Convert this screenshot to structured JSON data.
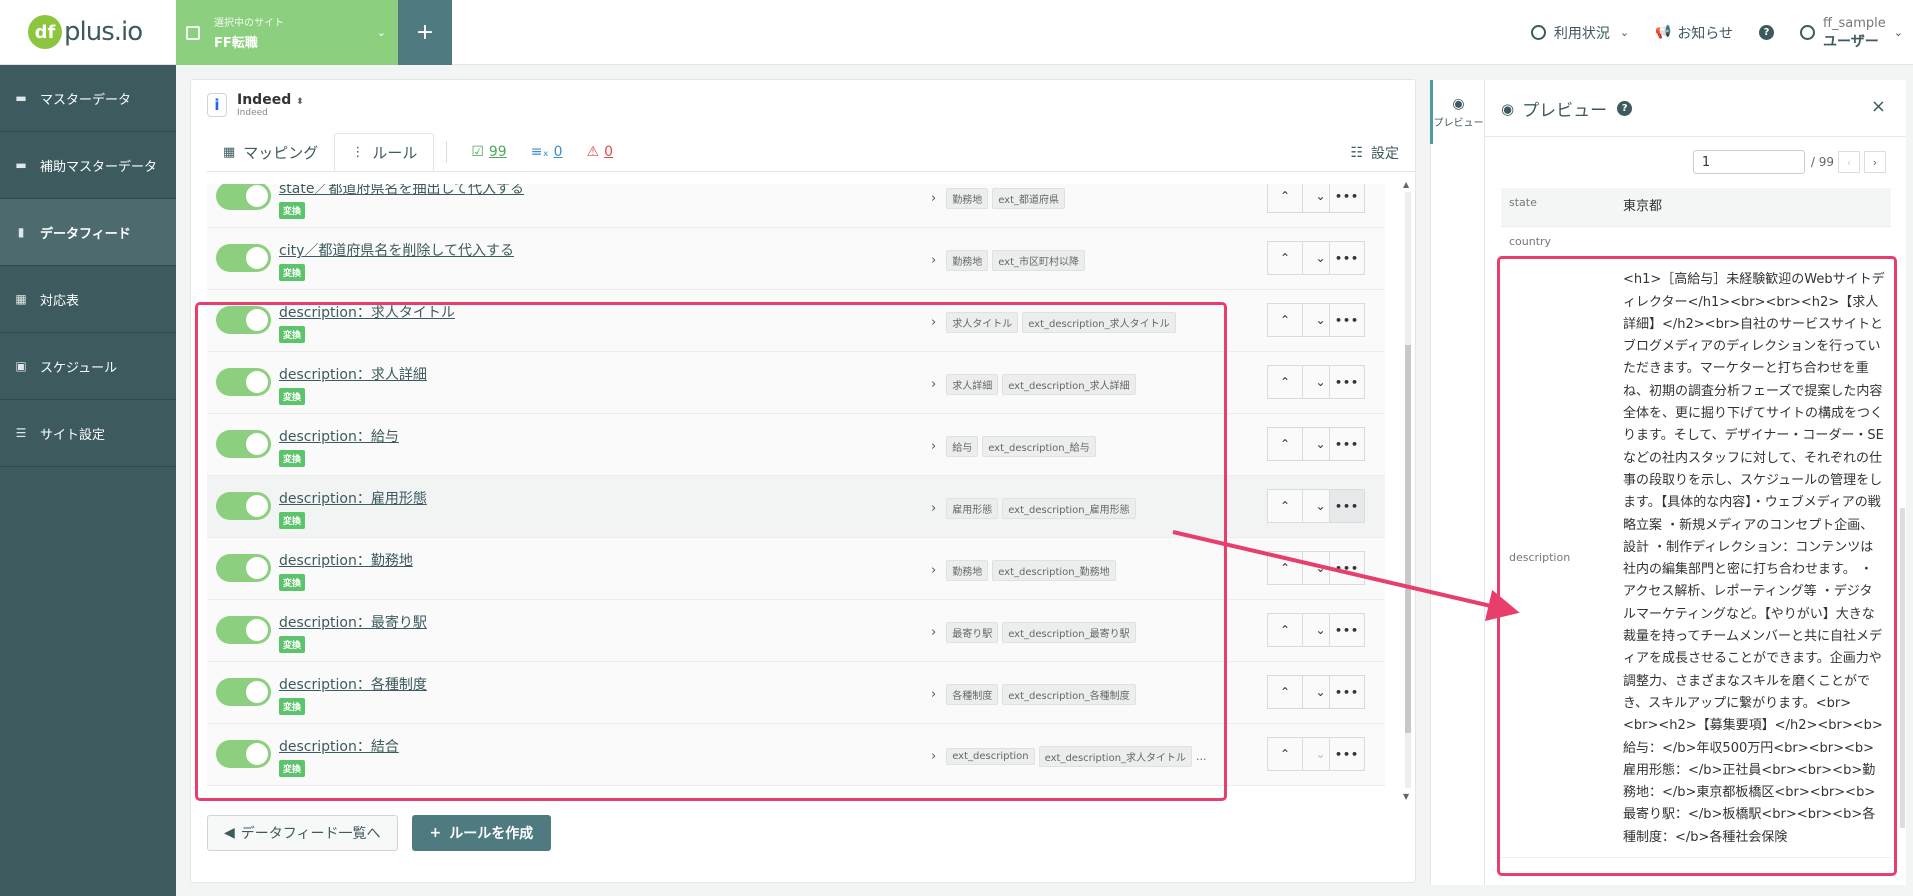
{
  "header": {
    "logo_text": "plus.io",
    "logo_badge": "df",
    "site_label": "選択中のサイト",
    "site_value": "FF転職",
    "add_label": "+",
    "usage_label": "利用状況",
    "news_label": "お知らせ",
    "help_label": "?",
    "user_name": "ff_sample",
    "user_role": "ユーザー"
  },
  "sidebar": {
    "items": [
      {
        "label": "マスターデータ",
        "icon": "folder-icon"
      },
      {
        "label": "補助マスターデータ",
        "icon": "folders-icon"
      },
      {
        "label": "データフィード",
        "icon": "file-icon"
      },
      {
        "label": "対応表",
        "icon": "table-icon"
      },
      {
        "label": "スケジュール",
        "icon": "calendar-icon"
      },
      {
        "label": "サイト設定",
        "icon": "sliders-icon"
      }
    ]
  },
  "feed": {
    "name": "Indeed",
    "sub": "Indeed",
    "icon_letter": "i"
  },
  "tabs": {
    "mapping": "マッピング",
    "rule": "ルール",
    "ok_count": "99",
    "filter_count": "0",
    "warn_count": "0",
    "settings": "設定"
  },
  "rules": [
    {
      "title": "state／都道府県名を抽出して代入する",
      "badge": "変換",
      "tags": [
        "勤務地",
        "ext_都道府県"
      ],
      "more": ""
    },
    {
      "title": "city／都道府県名を削除して代入する",
      "badge": "変換",
      "tags": [
        "勤務地",
        "ext_市区町村以降"
      ],
      "more": ""
    },
    {
      "title": "description：求人タイトル",
      "badge": "変換",
      "tags": [
        "求人タイトル",
        "ext_description_求人タイトル"
      ],
      "more": ""
    },
    {
      "title": "description：求人詳細",
      "badge": "変換",
      "tags": [
        "求人詳細",
        "ext_description_求人詳細"
      ],
      "more": ""
    },
    {
      "title": "description：給与",
      "badge": "変換",
      "tags": [
        "給与",
        "ext_description_給与"
      ],
      "more": ""
    },
    {
      "title": "description：雇用形態",
      "badge": "変換",
      "tags": [
        "雇用形態",
        "ext_description_雇用形態"
      ],
      "more": ""
    },
    {
      "title": "description：勤務地",
      "badge": "変換",
      "tags": [
        "勤務地",
        "ext_description_勤務地"
      ],
      "more": ""
    },
    {
      "title": "description：最寄り駅",
      "badge": "変換",
      "tags": [
        "最寄り駅",
        "ext_description_最寄り駅"
      ],
      "more": ""
    },
    {
      "title": "description：各種制度",
      "badge": "変換",
      "tags": [
        "各種制度",
        "ext_description_各種制度"
      ],
      "more": ""
    },
    {
      "title": "description：結合",
      "badge": "変換",
      "tags": [
        "ext_description",
        "ext_description_求人タイトル"
      ],
      "more": "..."
    }
  ],
  "footer": {
    "back_label": "データフィード一覧へ",
    "create_label": "ルールを作成"
  },
  "preview": {
    "tab_label": "プレビュー",
    "title": "プレビュー",
    "help": "?",
    "close": "×",
    "page_value": "1",
    "page_total": "/ 99",
    "rows": [
      {
        "key": "state",
        "value": "東京都"
      },
      {
        "key": "country",
        "value": ""
      },
      {
        "key": "description",
        "value": "<h1>［高給与］未経験歓迎のWebサイトディレクター</h1><br><br><h2>【求人詳細】</h2><br>自社のサービスサイトとブログメディアのディレクションを行っていただきます。マーケターと打ち合わせを重ね、初期の調査分析フェーズで提案した内容全体を、更に掘り下げてサイトの構成をつくります。そして、デザイナー・コーダー・SEなどの社内スタッフに対して、それぞれの仕事の段取りを示し、スケジュールの管理をします。【具体的な内容】・ウェブメディアの戦略立案 ・新規メディアのコンセプト企画、設計 ・制作ディレクション：コンテンツは社内の編集部門と密に打ち合わせます。 ・アクセス解析、レポーティング等 ・デジタルマーケティングなど。【やりがい】大きな裁量を持ってチームメンバーと共に自社メディアを成長させることができます。企画力や調整力、さまざまなスキルを磨くことができ、スキルアップに繋がります。<br><br><h2>【募集要項】</h2><br><b>給与：</b>年収500万円<br><br><b>雇用形態：</b>正社員<br><br><b>勤務地：</b>東京都板橋区<br><br><b>最寄り駅：</b>板橋駅<br><br><b>各種制度：</b>各種社会保険"
      }
    ]
  },
  "colors": {
    "sidebar": "#3d5a5e",
    "accent_green": "#8ccf7e",
    "highlight": "#e83e6c"
  }
}
